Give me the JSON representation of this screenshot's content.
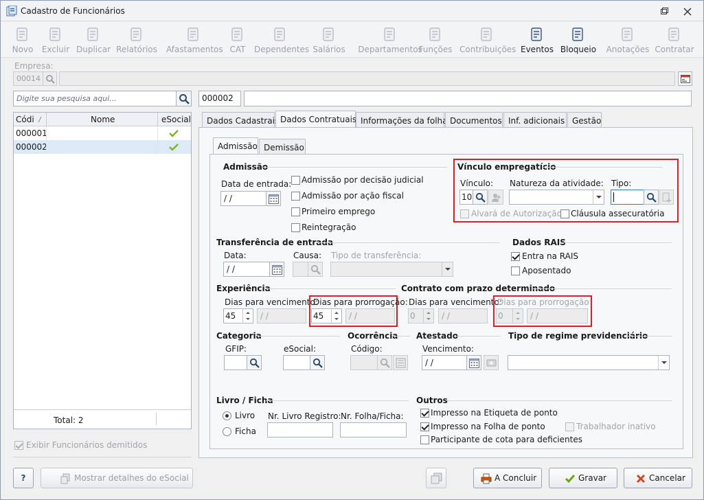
{
  "window": {
    "title": "Cadastro de Funcionários"
  },
  "toolbar": [
    {
      "label": "Novo",
      "icon": "new-doc-icon",
      "enabled": false
    },
    {
      "label": "Excluir",
      "icon": "trash-icon",
      "enabled": false
    },
    {
      "label": "Duplicar",
      "icon": "users-icon",
      "enabled": false
    },
    {
      "label": "Relatórios",
      "icon": "report-icon",
      "enabled": false
    },
    {
      "label": "Afastamentos",
      "icon": "house-icon",
      "enabled": false
    },
    {
      "label": "CAT",
      "icon": "plus-cross-icon",
      "enabled": false
    },
    {
      "label": "Dependentes",
      "icon": "dependents-icon",
      "enabled": false
    },
    {
      "label": "Salários",
      "icon": "money-icon",
      "enabled": false
    },
    {
      "label": "Departamentos",
      "icon": "desk-icon",
      "enabled": false
    },
    {
      "label": "Funções",
      "icon": "clipboard-icon",
      "enabled": false
    },
    {
      "label": "Contribuições",
      "icon": "head-icon",
      "enabled": false
    },
    {
      "label": "Eventos",
      "icon": "list-icon",
      "enabled": true
    },
    {
      "label": "Bloqueio",
      "icon": "lock-icon",
      "enabled": true
    },
    {
      "label": "Anotações",
      "icon": "notes-check-icon",
      "enabled": false
    },
    {
      "label": "Contratar",
      "icon": "contract-icon",
      "enabled": false
    }
  ],
  "empresa": {
    "label": "Empresa:",
    "code": "00014",
    "name": ""
  },
  "search": {
    "placeholder": "Digite sua pesquisa aqui...",
    "selected_code": "000002",
    "selected_name": ""
  },
  "grid": {
    "columns": [
      "Códi",
      "Nome",
      "eSocial"
    ],
    "rows": [
      {
        "code": "000001",
        "name": "",
        "esocial": true
      },
      {
        "code": "000002",
        "name": "",
        "esocial": true
      }
    ],
    "total": "Total: 2"
  },
  "show_dismissed": "Exibir Funcionários demitidos",
  "tabs": [
    "Dados Cadastrais",
    "Dados Contratuais",
    "Informações da folha",
    "Documentos",
    "Inf. adicionais",
    "Gestão"
  ],
  "subtabs": [
    "Admissão",
    "Demissão"
  ],
  "admissao": {
    "section": "Admissão",
    "data_entrada_label": "Data de entrada:",
    "data_entrada": " /  /",
    "checks": [
      "Admissão por decisão judicial",
      "Admissão por ação fiscal",
      "Primeiro emprego",
      "Reintegração"
    ]
  },
  "vinculo": {
    "section": "Vínculo empregatício",
    "vinculo_label": "Vínculo:",
    "vinculo_value": "10",
    "natureza_label": "Natureza da atividade:",
    "natureza_value": "",
    "tipo_label": "Tipo:",
    "tipo_value": "",
    "alvara": "Alvará de Autorização",
    "clausula": "Cláusula assecuratória"
  },
  "transferencia": {
    "section": "Transferência de entrada",
    "data_label": "Data:",
    "data": " /  /",
    "causa_label": "Causa:",
    "tipo_label": "Tipo de transferência:"
  },
  "rais": {
    "section": "Dados RAIS",
    "entra": "Entra na RAIS",
    "aposentado": "Aposentado"
  },
  "experiencia": {
    "section": "Experiência",
    "venc_label": "Dias para vencimento:",
    "venc_value": "45",
    "venc_date": " /  /",
    "prorr_label": "Dias para prorrogação:",
    "prorr_value": "45",
    "prorr_date": " /  /"
  },
  "contrato": {
    "section": "Contrato com prazo determinado",
    "venc_label": "Dias para vencimento:",
    "venc_value": "0",
    "venc_date": " /  /",
    "prorr_label": "Dias para prorrogação:",
    "prorr_value": "0",
    "prorr_date": " /  /"
  },
  "categoria": {
    "section": "Categoria",
    "gfip_label": "GFIP:",
    "esocial_label": "eSocial:"
  },
  "ocorrencia": {
    "section": "Ocorrência",
    "codigo_label": "Código:"
  },
  "atestado": {
    "section": "Atestado",
    "venc_label": "Vencimento:",
    "venc": " /  /"
  },
  "regime": {
    "section": "Tipo de regime previdenciário",
    "value": ""
  },
  "livro": {
    "section": "Livro / Ficha",
    "livro": "Livro",
    "ficha": "Ficha",
    "nr_livro_label": "Nr. Livro Registro:",
    "nr_folha_label": "Nr. Folha/Ficha:"
  },
  "outros": {
    "section": "Outros",
    "etiqueta": "Impresso na Etiqueta de ponto",
    "folha": "Impresso na Folha de ponto",
    "cota": "Participante de cota para deficientes",
    "inativo": "Trabalhador inativo"
  },
  "buttons": {
    "help": "?",
    "esocial_details": "Mostrar detalhes do eSocial",
    "concluir": "A Concluir",
    "gravar": "Gravar",
    "cancelar": "Cancelar"
  }
}
